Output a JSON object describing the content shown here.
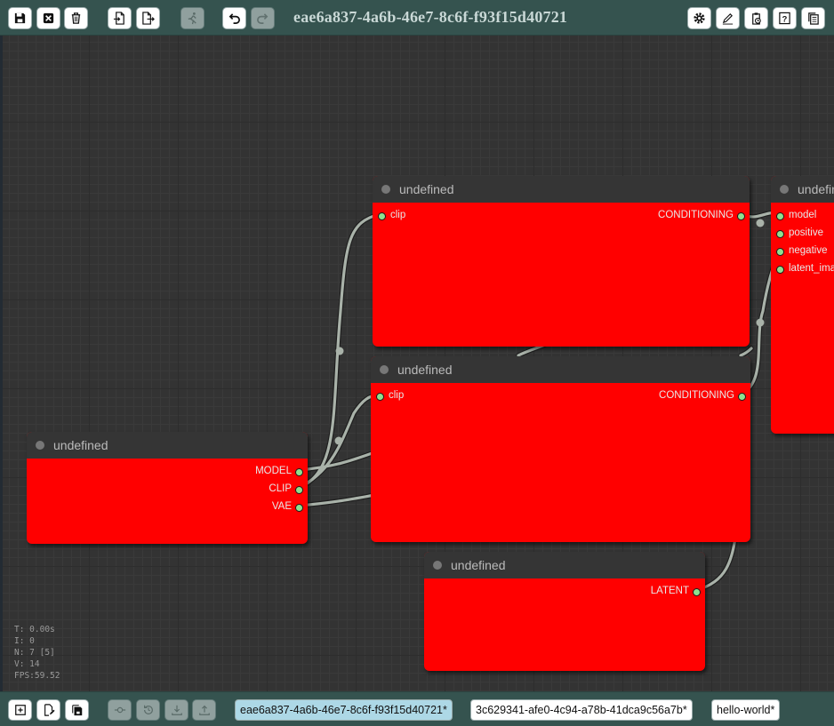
{
  "toolbar": {
    "title": "eae6a837-4a6b-46e7-8c6f-f93f15d40721",
    "buttons": [
      "save",
      "clear",
      "delete",
      "load",
      "export",
      "run",
      "undo",
      "redo",
      "settings",
      "edit",
      "clipboard-check",
      "help",
      "copy"
    ]
  },
  "nodes": [
    {
      "id": "checkpoint",
      "title": "undefined",
      "inputs": [],
      "outputs": [
        "MODEL",
        "CLIP",
        "VAE"
      ]
    },
    {
      "id": "clip_pos",
      "title": "undefined",
      "inputs": [
        "clip"
      ],
      "outputs": [
        "CONDITIONING"
      ]
    },
    {
      "id": "clip_neg",
      "title": "undefined",
      "inputs": [
        "clip"
      ],
      "outputs": [
        "CONDITIONING"
      ]
    },
    {
      "id": "latent",
      "title": "undefined",
      "inputs": [],
      "outputs": [
        "LATENT"
      ]
    },
    {
      "id": "sampler",
      "title": "undefined",
      "inputs": [
        "model",
        "positive",
        "negative",
        "latent_image"
      ],
      "outputs": []
    }
  ],
  "stats": {
    "t": "T: 0.00s",
    "i": "I: 0",
    "n": "N: 7 [5]",
    "v": "V: 14",
    "fps": "FPS:59.52"
  },
  "bottombar": {
    "tabs": [
      {
        "label": "eae6a837-4a6b-46e7-8c6f-f93f15d40721*",
        "active": true
      },
      {
        "label": "3c629341-afe0-4c94-a78b-41dca9c56a7b*",
        "active": false
      },
      {
        "label": "hello-world*",
        "active": false
      }
    ]
  },
  "colors": {
    "toolbar": "#35534f",
    "node_body": "#ff0000",
    "node_header": "#353535",
    "slot_pin": "#8fe08f",
    "link": "#a9b2a9",
    "active_tab": "#add8e6"
  }
}
